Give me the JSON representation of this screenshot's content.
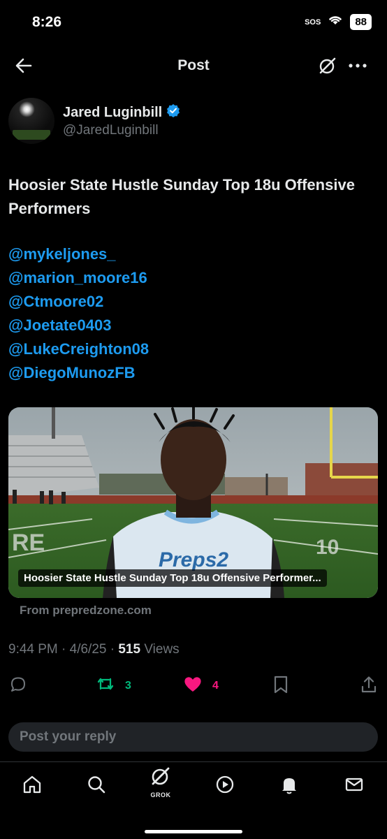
{
  "status": {
    "time": "8:26",
    "sos": "SOS",
    "battery": "88"
  },
  "nav": {
    "title": "Post"
  },
  "author": {
    "name": "Jared Luginbill",
    "handle": "@JaredLuginbill"
  },
  "post": {
    "text": "Hoosier State Hustle Sunday Top 18u Offensive Performers",
    "mentions": [
      "@mykeljones_",
      "@marion_moore16",
      "@Ctmoore02",
      "@Joetate0403",
      "@LukeCreighton08",
      "@DiegoMunozFB"
    ]
  },
  "card": {
    "caption": "Hoosier State Hustle Sunday Top 18u Offensive Performer...",
    "jersey_text": "Preps2",
    "source": "From prepredzone.com"
  },
  "meta": {
    "timestamp": "9:44 PM · 4/6/25 · ",
    "views_count": "515",
    "views_label": " Views"
  },
  "actions": {
    "reposts": "3",
    "likes": "4"
  },
  "reply": {
    "placeholder": "Post your reply"
  },
  "tabbar": {
    "grok_label": "GROK"
  },
  "colors": {
    "link": "#1d9bf0",
    "repost": "#00ba7c",
    "like": "#f91880",
    "muted": "#71767b"
  }
}
